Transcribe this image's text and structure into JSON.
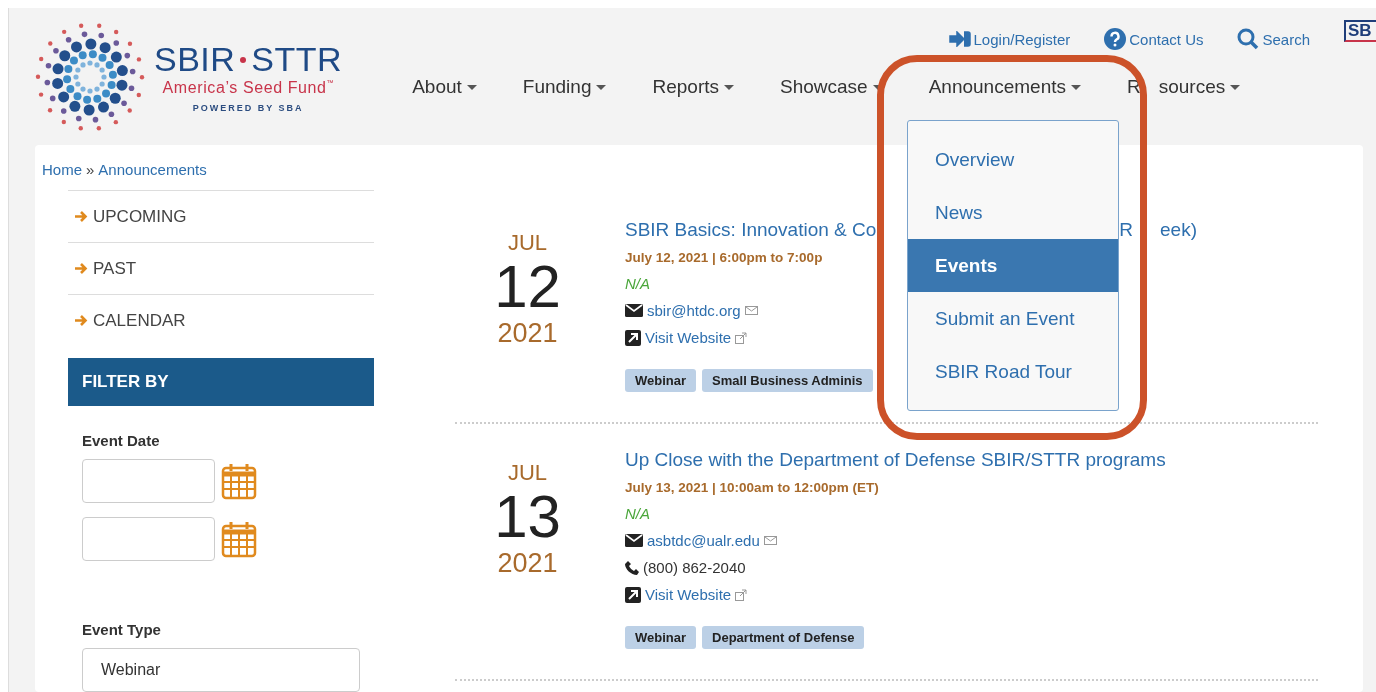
{
  "logo": {
    "word_left": "SBIR",
    "word_right": "STTR",
    "tagline": "America’s Seed Fund",
    "trademark": "™",
    "powered_by": "POWERED BY SBA"
  },
  "utility_links": [
    {
      "kind": "login",
      "label": "Login/Register"
    },
    {
      "kind": "contact",
      "label": "Contact Us"
    },
    {
      "kind": "search",
      "label": "Search"
    }
  ],
  "sba_logo": "SB",
  "nav": [
    {
      "label": "About"
    },
    {
      "label": "Funding"
    },
    {
      "label": "Reports"
    },
    {
      "label": "Showcase"
    },
    {
      "label": "Announcements"
    },
    {
      "label": "R",
      "label_end": "sources"
    }
  ],
  "dropdown": [
    {
      "label": "Overview",
      "selected": false
    },
    {
      "label": "News",
      "selected": false
    },
    {
      "label": "Events",
      "selected": true
    },
    {
      "label": "Submit an Event",
      "selected": false
    },
    {
      "label": "SBIR Road Tour",
      "selected": false
    }
  ],
  "breadcrumb": {
    "home": "Home",
    "separator": "»",
    "current": "Announcements"
  },
  "sidebar": {
    "links": [
      "UPCOMING",
      "PAST",
      "CALENDAR"
    ],
    "filter_heading": "FILTER BY",
    "event_date_label": "Event Date",
    "event_type_label": "Event Type",
    "event_type_value": "Webinar"
  },
  "events": [
    {
      "month": "JUL",
      "day": "12",
      "year": "2021",
      "title": "SBIR Basics: Innovation & Co",
      "title_end": [
        "R",
        "eek)"
      ],
      "datetime": "July 12, 2021 | 6:00pm to 7:00p",
      "location": "N/A",
      "email": "sbir@htdc.org",
      "website": "Visit Website",
      "tags": [
        "Webinar",
        "Small Business Adminis"
      ]
    },
    {
      "month": "JUL",
      "day": "13",
      "year": "2021",
      "title": "Up Close with the Department of Defense SBIR/STTR programs",
      "datetime": "July 13, 2021 | 10:00am to 12:00pm (ET)",
      "location": "N/A",
      "email": "asbtdc@ualr.edu",
      "phone": "(800) 862-2040",
      "website": "Visit Website",
      "tags": [
        "Webinar",
        "Department of Defense"
      ]
    }
  ]
}
